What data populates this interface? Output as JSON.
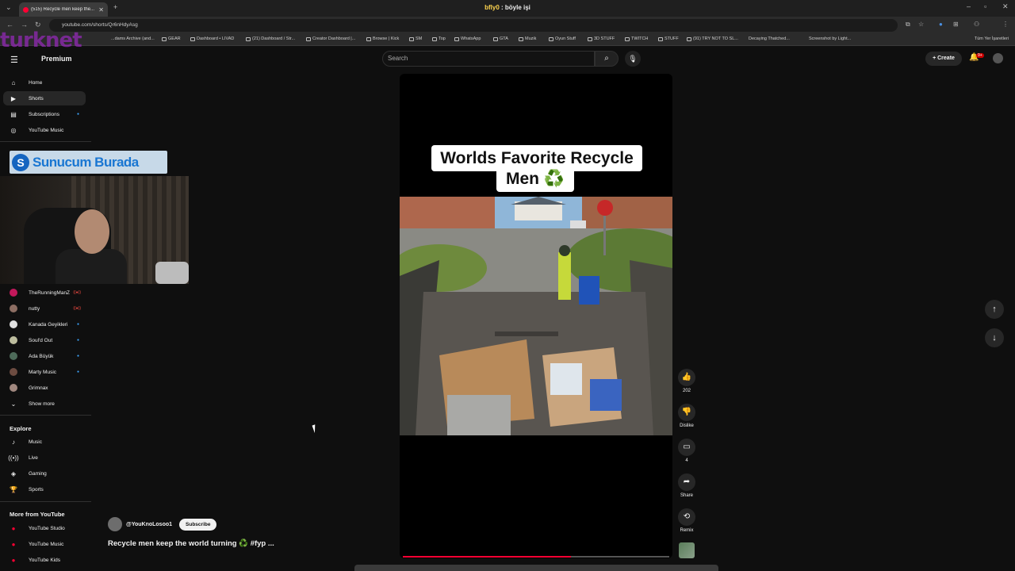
{
  "browser": {
    "tab_title": "(515) Recycle men keep the...",
    "tab_close": "✕",
    "new_tab": "+",
    "stream_title_user": "bfly0",
    "stream_title_text": " : böyle işi",
    "url": "youtube.com/shorts/Qr6nHdyAsg",
    "bookmarks": [
      "...dams Archive (and...",
      "GEAR",
      "Dashboard • LIVAD",
      "(21) Dashboard / Str...",
      "Creator Dashboard |...",
      "Browse | Kick",
      "SM",
      "Top",
      "WhatsApp",
      "GTA",
      "Muzik",
      "Oyun Stuff",
      "3D STUFF",
      "TWITCH",
      "STUFF",
      "(91) TRY NOT TO SL...",
      "Decaying Thatched...",
      "Screenshot by Light..."
    ],
    "bookmarks_right": "Tüm Yer İşaretleri"
  },
  "overlay": {
    "watermark": "turknet",
    "banner": "Sunucum Burada"
  },
  "header": {
    "logo_label": "Premium",
    "search_placeholder": "Search",
    "create_label": "Create",
    "notif_badge": "9+"
  },
  "sidebar": {
    "main": [
      {
        "label": "Home",
        "icon": "home-icon"
      },
      {
        "label": "Shorts",
        "icon": "shorts-icon"
      },
      {
        "label": "Subscriptions",
        "icon": "subscriptions-icon"
      },
      {
        "label": "YouTube Music",
        "icon": "music-circle-icon"
      }
    ],
    "subscriptions": [
      {
        "label": "TheRunningManZ",
        "status": "live"
      },
      {
        "label": "nutty",
        "status": "live"
      },
      {
        "label": "Kanada Geyikleri",
        "status": "dot"
      },
      {
        "label": "Soul'd Out",
        "status": "dot"
      },
      {
        "label": "Ada Büyük",
        "status": "dot"
      },
      {
        "label": "Marty Music",
        "status": "dot"
      },
      {
        "label": "Grimnax",
        "status": "none"
      }
    ],
    "show_more": "Show more",
    "explore_header": "Explore",
    "explore": [
      "Music",
      "Live",
      "Gaming",
      "Sports"
    ],
    "more_header": "More from YouTube",
    "more": [
      "YouTube Studio",
      "YouTube Music",
      "YouTube Kids"
    ]
  },
  "short": {
    "caption_line1": "Worlds Favorite Recycle",
    "caption_line2": "Men ♻️",
    "channel": "@YouKnoLosoo1",
    "subscribe_label": "Subscribe",
    "title": "Recycle men keep the world turning ♻️ #fyp ...",
    "progress": 0.63
  },
  "actions": {
    "like_count": "202",
    "dislike_label": "Dislike",
    "comment_count": "4",
    "share_label": "Share",
    "remix_label": "Remix"
  },
  "colors": {
    "background": "#0f0f0f",
    "accent_red": "#ff0033",
    "live_red": "#ff4e45",
    "dot_blue": "#3ea6ff"
  }
}
